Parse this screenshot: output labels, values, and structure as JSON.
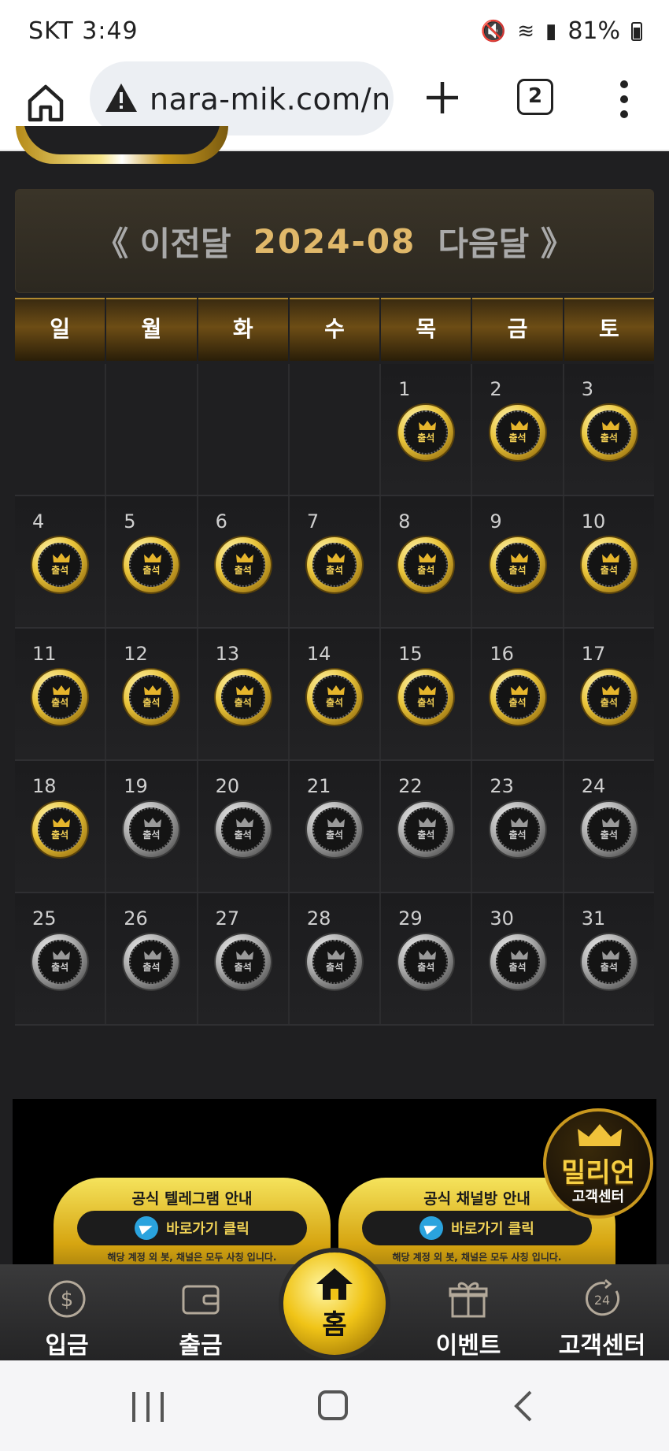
{
  "status_bar": {
    "carrier_time": "SKT 3:49",
    "battery": "81%"
  },
  "browser": {
    "url": "nara-mik.com/n",
    "tab_count": "2",
    "icons": [
      "home-icon",
      "warning-icon",
      "plus-icon",
      "tabs-icon",
      "more-icon"
    ]
  },
  "calendar": {
    "prev_label": "《 이전달",
    "month": "2024-08",
    "next_label": "다음달 》",
    "weekdays": [
      "일",
      "월",
      "화",
      "수",
      "목",
      "금",
      "토"
    ],
    "stamp_label": "출석",
    "attended_through": 18,
    "weeks": [
      [
        "",
        "",
        "",
        "",
        "1",
        "2",
        "3"
      ],
      [
        "4",
        "5",
        "6",
        "7",
        "8",
        "9",
        "10"
      ],
      [
        "11",
        "12",
        "13",
        "14",
        "15",
        "16",
        "17"
      ],
      [
        "18",
        "19",
        "20",
        "21",
        "22",
        "23",
        "24"
      ],
      [
        "25",
        "26",
        "27",
        "28",
        "29",
        "30",
        "31"
      ]
    ]
  },
  "promo": {
    "card1_title": "공식 텔레그램 안내",
    "card2_title": "공식 채널방 안내",
    "button_label": "바로가기 클릭",
    "note": "해당 계정 외 봇, 채널은 모두 사칭 입니다.",
    "badge_big": "밀리언",
    "badge_small": "고객센터"
  },
  "bottom_nav": {
    "deposit": "입금",
    "withdraw": "출금",
    "home": "홈",
    "event": "이벤트",
    "support": "고객센터"
  },
  "colors": {
    "gold": "#e6b52c",
    "month_text": "#e0b86a",
    "background": "#1f1f21"
  }
}
